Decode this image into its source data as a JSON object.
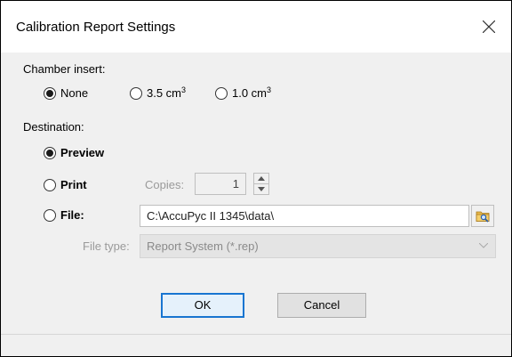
{
  "window": {
    "title": "Calibration Report Settings",
    "close_glyph": "close-icon"
  },
  "chamber_insert": {
    "label": "Chamber insert:",
    "options": [
      {
        "label": "None",
        "checked": true
      },
      {
        "label_value": "3.5 cm",
        "label_unit": "3",
        "checked": false
      },
      {
        "label_value": "1.0 cm",
        "label_unit": "3",
        "checked": false
      }
    ]
  },
  "destination": {
    "label": "Destination:",
    "options": [
      {
        "label": "Preview",
        "checked": true
      },
      {
        "label": "Print",
        "checked": false
      },
      {
        "label": "File:",
        "checked": false
      }
    ],
    "copies_label": "Copies:",
    "copies_value": "1",
    "file_path": "C:\\AccuPyc II 1345\\data\\",
    "file_type_label": "File type:",
    "file_type_value": "Report System (*.rep)"
  },
  "buttons": {
    "ok": "OK",
    "cancel": "Cancel"
  }
}
